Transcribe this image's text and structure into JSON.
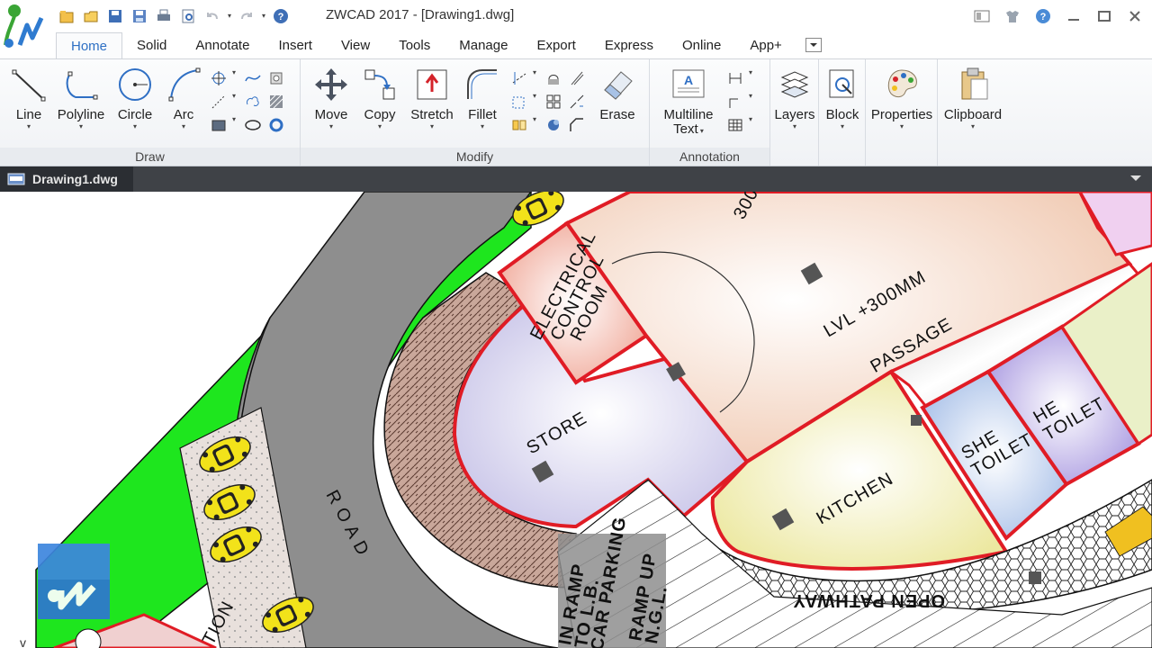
{
  "window": {
    "title": "ZWCAD 2017 - [Drawing1.dwg]"
  },
  "quick_access": {
    "icons": [
      "new-icon",
      "open-icon",
      "save-icon",
      "save-as-icon",
      "print-icon",
      "plot-preview-icon",
      "undo-icon",
      "redo-icon",
      "help-icon"
    ]
  },
  "ribbon": {
    "tabs": [
      {
        "label": "Home",
        "active": true
      },
      {
        "label": "Solid"
      },
      {
        "label": "Annotate"
      },
      {
        "label": "Insert"
      },
      {
        "label": "View"
      },
      {
        "label": "Tools"
      },
      {
        "label": "Manage"
      },
      {
        "label": "Export"
      },
      {
        "label": "Express"
      },
      {
        "label": "Online"
      },
      {
        "label": "App+"
      }
    ],
    "panels": {
      "draw": {
        "title": "Draw",
        "line": "Line",
        "polyline": "Polyline",
        "circle": "Circle",
        "arc": "Arc"
      },
      "modify": {
        "title": "Modify",
        "move": "Move",
        "copy": "Copy",
        "stretch": "Stretch",
        "fillet": "Fillet",
        "erase": "Erase"
      },
      "annotation": {
        "title": "Annotation",
        "mtext_line1": "Multiline",
        "mtext_line2": "Text"
      },
      "layers": "Layers",
      "block": "Block",
      "properties": "Properties",
      "clipboard": "Clipboard"
    }
  },
  "document": {
    "tab_label": "Drawing1.dwg"
  },
  "drawing": {
    "labels": {
      "electrical": [
        "ELECTRICAL",
        "CONTROL",
        "ROOM"
      ],
      "level": "LVL +300MM",
      "passage": "PASSAGE",
      "he_toilet": [
        "HE",
        "TOILET"
      ],
      "she_toilet": [
        "SHE",
        "TOILET"
      ],
      "store": "STORE",
      "kitchen": "KITCHEN",
      "road": "R O A D",
      "ramp": [
        "IN RAMP",
        "TO L.B.",
        "CAR PARKING"
      ],
      "ramp_up": [
        "RAMP UP",
        "N.G.L."
      ],
      "pathway": "OPEN PATHWAY",
      "top_dim": "300",
      "station": "TION"
    },
    "colors": {
      "road": "#8e8e8e",
      "grass": "#1ee61e",
      "wall": "#e01c25",
      "kitchen": "#f4f0b8",
      "toilet_he": "#b9a8e8",
      "toilet_she": "#b8cbe8",
      "car": "#f0e020"
    }
  }
}
